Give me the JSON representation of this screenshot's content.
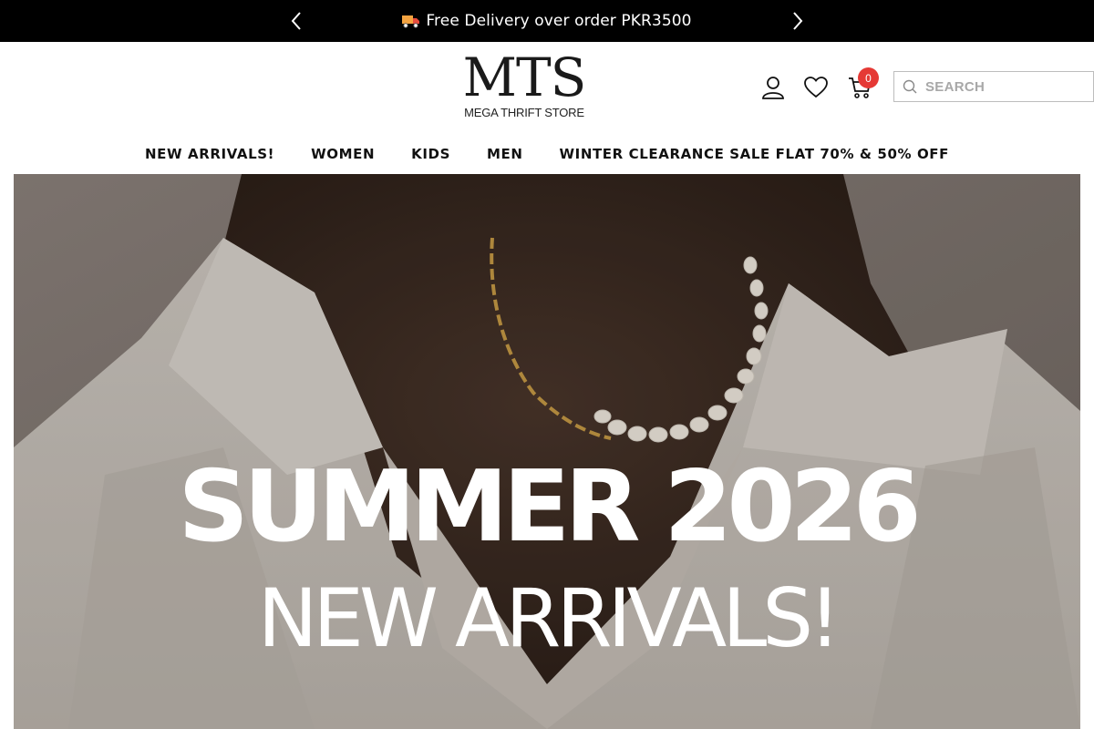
{
  "announcement": {
    "icon": "truck-icon",
    "text": "Free Delivery over order PKR3500"
  },
  "brand": {
    "logo_mark": "MTS",
    "logo_sub": "MEGA THRIFT STORE"
  },
  "header": {
    "cart_count": "0",
    "search_placeholder": "SEARCH",
    "badge_color": "#e53935"
  },
  "nav": {
    "items": [
      {
        "label": "NEW ARRIVALS!"
      },
      {
        "label": "WOMEN"
      },
      {
        "label": "KIDS"
      },
      {
        "label": "MEN"
      },
      {
        "label": "WINTER CLEARANCE SALE FLAT 70% & 50% OFF"
      }
    ]
  },
  "hero": {
    "headline": "SUMMER 2026",
    "subline": "NEW ARRIVALS!"
  }
}
